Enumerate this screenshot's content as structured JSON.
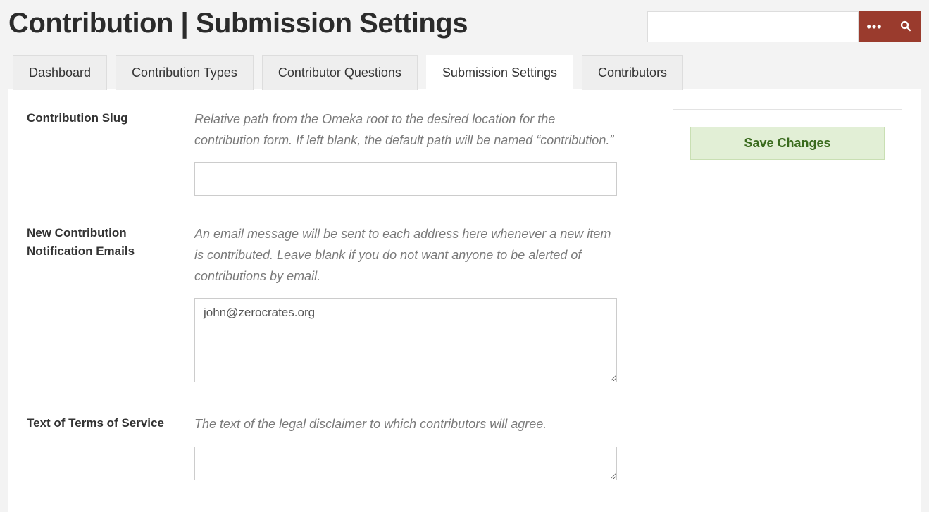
{
  "page_title": "Contribution | Submission Settings",
  "search": {
    "value": "",
    "placeholder": ""
  },
  "tabs": {
    "dashboard": "Dashboard",
    "types": "Contribution Types",
    "questions": "Contributor Questions",
    "settings": "Submission Settings",
    "contributors": "Contributors",
    "active": "settings"
  },
  "fields": {
    "slug": {
      "label": "Contribution Slug",
      "desc": "Relative path from the Omeka root to the desired location for the contribution form. If left blank, the default path will be named “contribution.”",
      "value": ""
    },
    "emails": {
      "label": "New Contribution Notification Emails",
      "desc": "An email message will be sent to each address here whenever a new item is contributed. Leave blank if you do not want anyone to be alerted of contributions by email.",
      "value": "john@zerocrates.org"
    },
    "tos": {
      "label": "Text of Terms of Service",
      "desc": "The text of the legal disclaimer to which contributors will agree.",
      "value": ""
    }
  },
  "buttons": {
    "save": "Save Changes"
  }
}
